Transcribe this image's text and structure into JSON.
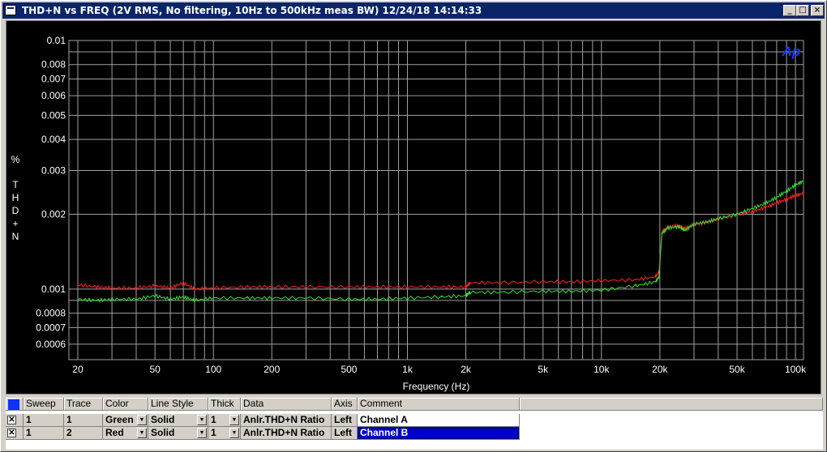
{
  "window": {
    "title": "THD+N vs FREQ (2V RMS, No filtering, 10Hz to 500kHz meas BW)  12/24/18 14:14:33",
    "buttons": {
      "minimize": "_",
      "maximize": "□",
      "close": "×"
    }
  },
  "chart_data": {
    "type": "line",
    "title": "",
    "xlabel": "Frequency (Hz)",
    "ylabel": "% THD+N",
    "ylabel_letters": [
      "%",
      "T",
      "H",
      "D",
      "+",
      "N"
    ],
    "xscale": "log",
    "yscale": "log",
    "xlim": [
      18,
      110000
    ],
    "ylim": [
      0.00052,
      0.01
    ],
    "grid": true,
    "logo": "Ap",
    "x_ticks": [
      {
        "value": 20,
        "label": "20"
      },
      {
        "value": 50,
        "label": "50"
      },
      {
        "value": 100,
        "label": "100"
      },
      {
        "value": 200,
        "label": "200"
      },
      {
        "value": 500,
        "label": "500"
      },
      {
        "value": 1000,
        "label": "1k"
      },
      {
        "value": 2000,
        "label": "2k"
      },
      {
        "value": 5000,
        "label": "5k"
      },
      {
        "value": 10000,
        "label": "10k"
      },
      {
        "value": 20000,
        "label": "20k"
      },
      {
        "value": 50000,
        "label": "50k"
      },
      {
        "value": 100000,
        "label": "100k"
      }
    ],
    "y_ticks": [
      {
        "value": 0.01,
        "label": "0.01"
      },
      {
        "value": 0.008,
        "label": "0.008"
      },
      {
        "value": 0.007,
        "label": "0.007"
      },
      {
        "value": 0.006,
        "label": "0.006"
      },
      {
        "value": 0.005,
        "label": "0.005"
      },
      {
        "value": 0.004,
        "label": "0.004"
      },
      {
        "value": 0.003,
        "label": "0.003"
      },
      {
        "value": 0.002,
        "label": "0.002"
      },
      {
        "value": 0.001,
        "label": "0.001"
      },
      {
        "value": 0.0008,
        "label": "0.0008"
      },
      {
        "value": 0.0007,
        "label": "0.0007"
      },
      {
        "value": 0.0006,
        "label": "0.0006"
      }
    ],
    "series": [
      {
        "color": "#ff2020",
        "x": [
          20,
          25,
          30,
          40,
          50,
          60,
          70,
          80,
          100,
          150,
          200,
          300,
          500,
          700,
          1000,
          1500,
          2000,
          2100,
          3000,
          5000,
          7000,
          10000,
          15000,
          19000,
          19800,
          20500,
          22000,
          25000,
          27000,
          30000,
          35000,
          40000,
          50000,
          60000,
          70000,
          80000,
          90000,
          100000,
          110000
        ],
        "y": [
          0.00104,
          0.00102,
          0.00101,
          0.00101,
          0.00103,
          0.00101,
          0.00106,
          0.001,
          0.00101,
          0.00102,
          0.00102,
          0.00102,
          0.00102,
          0.00102,
          0.00102,
          0.00102,
          0.00102,
          0.00106,
          0.00106,
          0.00107,
          0.00107,
          0.00108,
          0.00109,
          0.00112,
          0.00118,
          0.0017,
          0.00178,
          0.0018,
          0.00175,
          0.00182,
          0.00186,
          0.00191,
          0.00199,
          0.00205,
          0.00213,
          0.00222,
          0.0023,
          0.00238,
          0.00242
        ]
      },
      {
        "color": "#30e030",
        "x": [
          20,
          25,
          30,
          40,
          50,
          60,
          70,
          80,
          100,
          150,
          200,
          300,
          500,
          700,
          1000,
          1500,
          2000,
          2100,
          3000,
          5000,
          7000,
          10000,
          15000,
          19000,
          19800,
          20500,
          22000,
          25000,
          27000,
          30000,
          35000,
          40000,
          50000,
          60000,
          70000,
          80000,
          90000,
          100000,
          110000
        ],
        "y": [
          0.00091,
          0.0009,
          0.00091,
          0.00091,
          0.00094,
          0.00091,
          0.00093,
          0.0009,
          0.00092,
          0.00092,
          0.00092,
          0.00092,
          0.00091,
          0.00091,
          0.00092,
          0.00093,
          0.00094,
          0.00097,
          0.00097,
          0.00098,
          0.00098,
          0.00099,
          0.00103,
          0.00107,
          0.00112,
          0.00167,
          0.00176,
          0.00178,
          0.00172,
          0.00183,
          0.00186,
          0.00192,
          0.002,
          0.00211,
          0.00221,
          0.00234,
          0.00248,
          0.00262,
          0.00272
        ]
      }
    ]
  },
  "table": {
    "headers": [
      "Sweep",
      "Trace",
      "Color",
      "Line Style",
      "Thick",
      "Data",
      "Axis",
      "Comment"
    ],
    "rows": [
      {
        "checked": "✕",
        "sweep": "1",
        "trace": "1",
        "color": "Green",
        "style": "Solid",
        "thick": "1",
        "data": "Anlr.THD+N Ratio",
        "axis": "Left",
        "comment": "Channel A"
      },
      {
        "checked": "✕",
        "sweep": "1",
        "trace": "2",
        "color": "Red",
        "style": "Solid",
        "thick": "1",
        "data": "Anlr.THD+N Ratio",
        "axis": "Left",
        "comment": "Channel B"
      }
    ],
    "dropdown_glyph": "▼"
  },
  "colors": {
    "titlebar": "#0a246a",
    "plot_background": "#000000",
    "grid": "#a0a0a0",
    "selection": "#0000cc"
  }
}
